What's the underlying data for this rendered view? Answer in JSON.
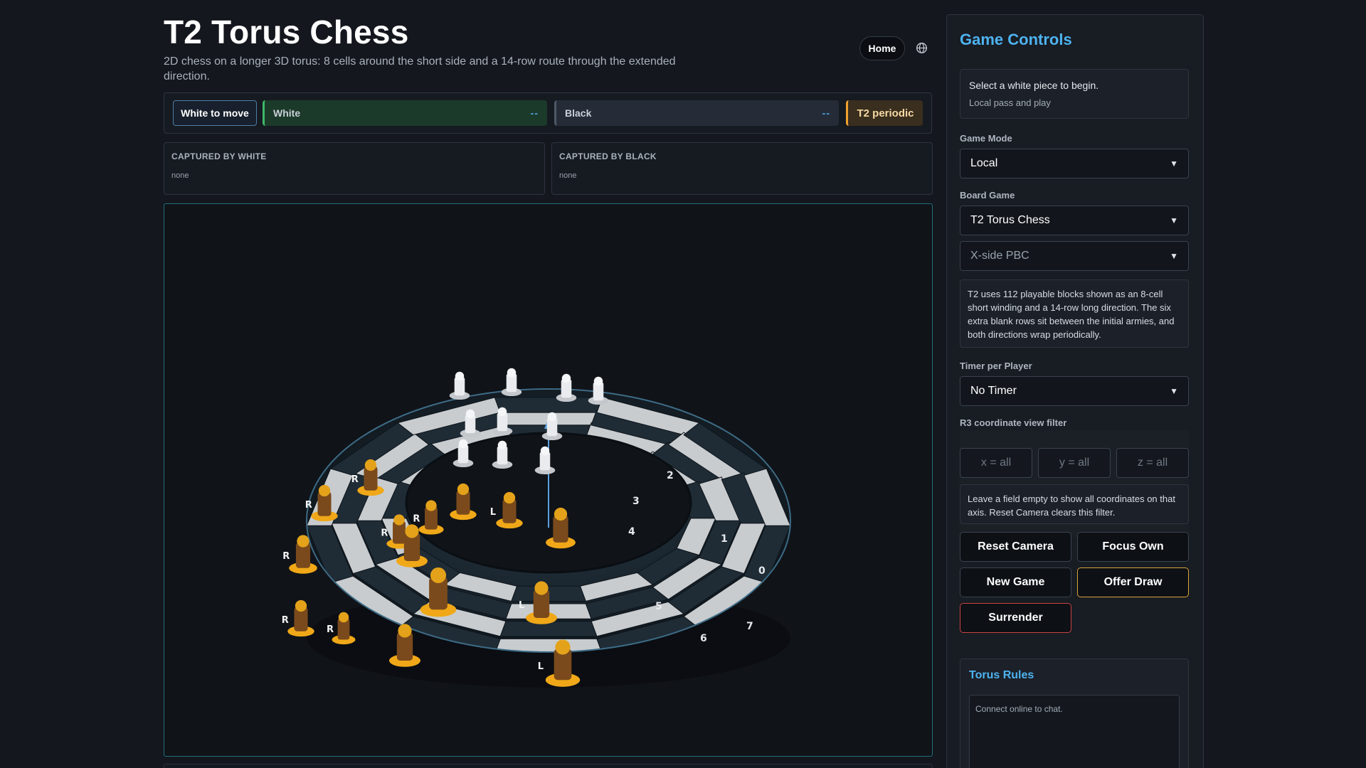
{
  "header": {
    "title": "T2 Torus Chess",
    "subtitle": "2D chess on a longer 3D torus: 8 cells around the short side and a 14-row route through the extended direction.",
    "home_label": "Home",
    "language_icon": "globe-icon"
  },
  "status": {
    "turn": "White to move",
    "white_label": "White",
    "white_timer": "--",
    "black_label": "Black",
    "black_timer": "--",
    "mode_badge": "T2 periodic"
  },
  "captured": {
    "white_title": "CAPTURED BY WHITE",
    "white_value": "none",
    "black_title": "CAPTURED BY BLACK",
    "black_value": "none"
  },
  "board": {
    "cell_labels": [
      "0",
      "1",
      "2",
      "3",
      "4",
      "5",
      "6",
      "7"
    ],
    "rook_label": "R",
    "piece_label": "L",
    "colors": {
      "light_cell": "#c8cccf",
      "dark_cell": "#1f2c36",
      "black_piece": "#e3a21a",
      "white_piece": "#dcdcdc"
    }
  },
  "controls": {
    "title": "Game Controls",
    "message": "Select a white piece to begin.",
    "message_sub": "Local pass and play",
    "game_mode_label": "Game Mode",
    "game_mode_value": "Local",
    "board_game_label": "Board Game",
    "board_game_value": "T2 Torus Chess",
    "boundary_value": "X-side PBC",
    "board_info": "T2 uses 112 playable blocks shown as an 8-cell short winding and a 14-row long direction. The six extra blank rows sit between the initial armies, and both directions wrap periodically.",
    "timer_label": "Timer per Player",
    "timer_value": "No Timer",
    "filter_label": "R3 coordinate view filter",
    "filter_x_placeholder": "x = all",
    "filter_y_placeholder": "y = all",
    "filter_z_placeholder": "z = all",
    "filter_info": "Leave a field empty to show all coordinates on that axis. Reset Camera clears this filter.",
    "reset_camera": "Reset Camera",
    "focus_own": "Focus Own",
    "new_game": "New Game",
    "offer_draw": "Offer Draw",
    "surrender": "Surrender",
    "rules_title": "Torus Rules",
    "chat_placeholder": "Connect online to chat."
  },
  "accent_colors": {
    "title_blue": "#4db3f0",
    "white_player": "#3fb86a",
    "mode_orange": "#f0a12e",
    "draw_gold": "#d9a33a",
    "surrender_red": "#c8423f"
  }
}
